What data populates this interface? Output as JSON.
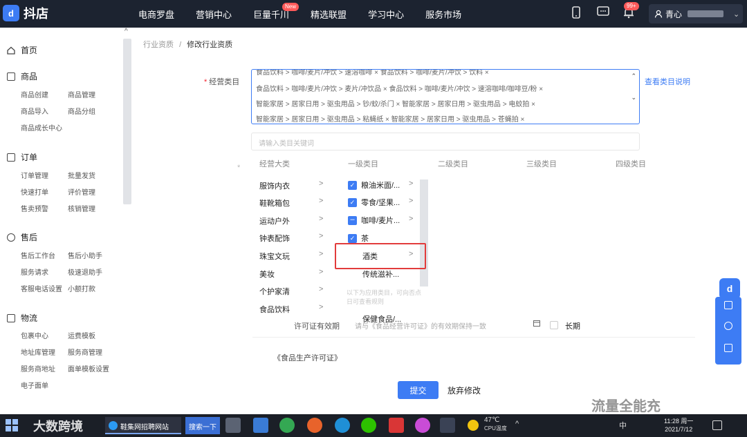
{
  "app": {
    "logo_mark": "d",
    "logo_text": "抖店"
  },
  "nav": [
    {
      "label": "电商罗盘"
    },
    {
      "label": "营销中心"
    },
    {
      "label": "巨量千川",
      "badge": "New"
    },
    {
      "label": "精选联盟"
    },
    {
      "label": "学习中心"
    },
    {
      "label": "服务市场"
    }
  ],
  "header": {
    "notif_badge": "99+",
    "user_name": "青心",
    "chevron": "⌄"
  },
  "sidebar": {
    "home": "首页",
    "sections": [
      {
        "title": "商品",
        "links": [
          "商品创建",
          "商品管理",
          "商品导入",
          "商品分组",
          "商品成长中心"
        ]
      },
      {
        "title": "订单",
        "links": [
          "订单管理",
          "批量发货",
          "快速打单",
          "评价管理",
          "售卖预警",
          "核销管理"
        ]
      },
      {
        "title": "售后",
        "links": [
          "售后工作台",
          "售后小助手",
          "服务请求",
          "极速退助手",
          "客服电话设置",
          "小额打款"
        ]
      },
      {
        "title": "物流",
        "links": [
          "包裹中心",
          "运费模板",
          "地址库管理",
          "服务商管理",
          "服务商地址",
          "面单模板设置",
          "电子面单"
        ]
      }
    ]
  },
  "breadcrumb": {
    "parent": "行业资质",
    "sep": "/",
    "current": "修改行业资质"
  },
  "form": {
    "category_label": "经营类目",
    "category_help": "查看类目说明",
    "selected_tags": [
      "食品饮料 > 咖啡/麦片/冲饮 > 速溶咖啡 ×   食品饮料 > 咖啡/麦片/冲饮 > 饮料 ×",
      "食品饮料 > 咖啡/麦片/冲饮 > 麦片/冲饮品 ×   食品饮料 > 咖啡/麦片/冲饮 > 速溶咖啡/咖啡豆/粉 ×",
      "智能家居 > 居家日用 > 驱虫用品 > 钞/蚊/杀门 ×   智能家居 > 居家日用 > 驱虫用品 > 电蚊拍 ×",
      "智能家居 > 居家日用 > 驱虫用品 > 粘蝇纸 ×   智能家居 > 居家日用 > 驱虫用品 > 苍蝇拍 ×"
    ],
    "search_placeholder": "请输入类目关键词",
    "columns": [
      "经营大类",
      "一级类目",
      "二级类目",
      "三级类目",
      "四级类目"
    ],
    "major_categories": [
      "服饰内衣",
      "鞋靴箱包",
      "运动户外",
      "钟表配饰",
      "珠宝文玩",
      "美妆",
      "个护家清",
      "食品饮料"
    ],
    "level1": [
      {
        "label": "粮油米面/...",
        "state": "checked"
      },
      {
        "label": "零食/坚果...",
        "state": "checked"
      },
      {
        "label": "咖啡/麦片...",
        "state": "partial"
      },
      {
        "label": "茶",
        "state": "checked"
      },
      {
        "label": "酒类",
        "state": "none"
      },
      {
        "label": "传统滋补...",
        "state": "none"
      },
      {
        "label": "保健食品/...",
        "state": "none"
      }
    ],
    "level1_hint": "以下为应用类目，可向否点日可查看规则",
    "license_label": "许可证有效期",
    "license_placeholder": "请与《食品经营许可证》的有效期保持一致",
    "long_term": "长期",
    "doc_label": "《食品生产许可证》",
    "submit": "提交",
    "discard": "放弃修改"
  },
  "watermarks": {
    "left": "大数跨境",
    "right": "流量全能充"
  },
  "taskbar": {
    "task_title": "鞋集网招聘网站",
    "search": "搜索一下",
    "ime": "中",
    "time": "11:28 周一",
    "date": "2021/7/12",
    "temp": "47℃",
    "temp_label": "CPU温度"
  }
}
